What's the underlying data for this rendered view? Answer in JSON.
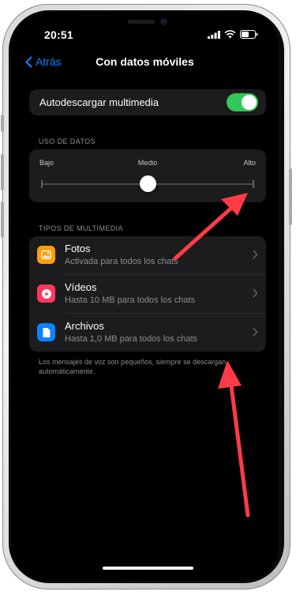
{
  "status_bar": {
    "time": "20:51",
    "icons": [
      "cellular-signal-icon",
      "wifi-icon",
      "battery-icon"
    ]
  },
  "nav": {
    "back_label": "Atrás",
    "title": "Con datos móviles"
  },
  "autodownload": {
    "label": "Autodescargar multimedia",
    "enabled": true
  },
  "data_usage": {
    "header": "USO DE DATOS",
    "labels": [
      "Bajo",
      "Medio",
      "Alto"
    ],
    "selected": "Medio",
    "selected_fraction": 0.5
  },
  "media_types": {
    "header": "TIPOS DE MULTIMEDIA",
    "items": [
      {
        "title": "Fotos",
        "subtitle": "Activada para todos los chats",
        "icon": "photo-icon",
        "color": "#ff9f0a"
      },
      {
        "title": "Vídeos",
        "subtitle": "Hasta 10 MB para todos los chats",
        "icon": "play-icon",
        "color": "#ff375f"
      },
      {
        "title": "Archivos",
        "subtitle": "Hasta 1,0 MB para todos los chats",
        "icon": "document-icon",
        "color": "#0a84ff"
      }
    ]
  },
  "footnote": "Los mensajes de voz son pequeños, siempre se descargan automáticamente.",
  "colors": {
    "accent": "#0a84ff",
    "toggle_on": "#34c759",
    "card_bg": "#1c1c1e",
    "annotation_arrow": "#ff3b47"
  }
}
